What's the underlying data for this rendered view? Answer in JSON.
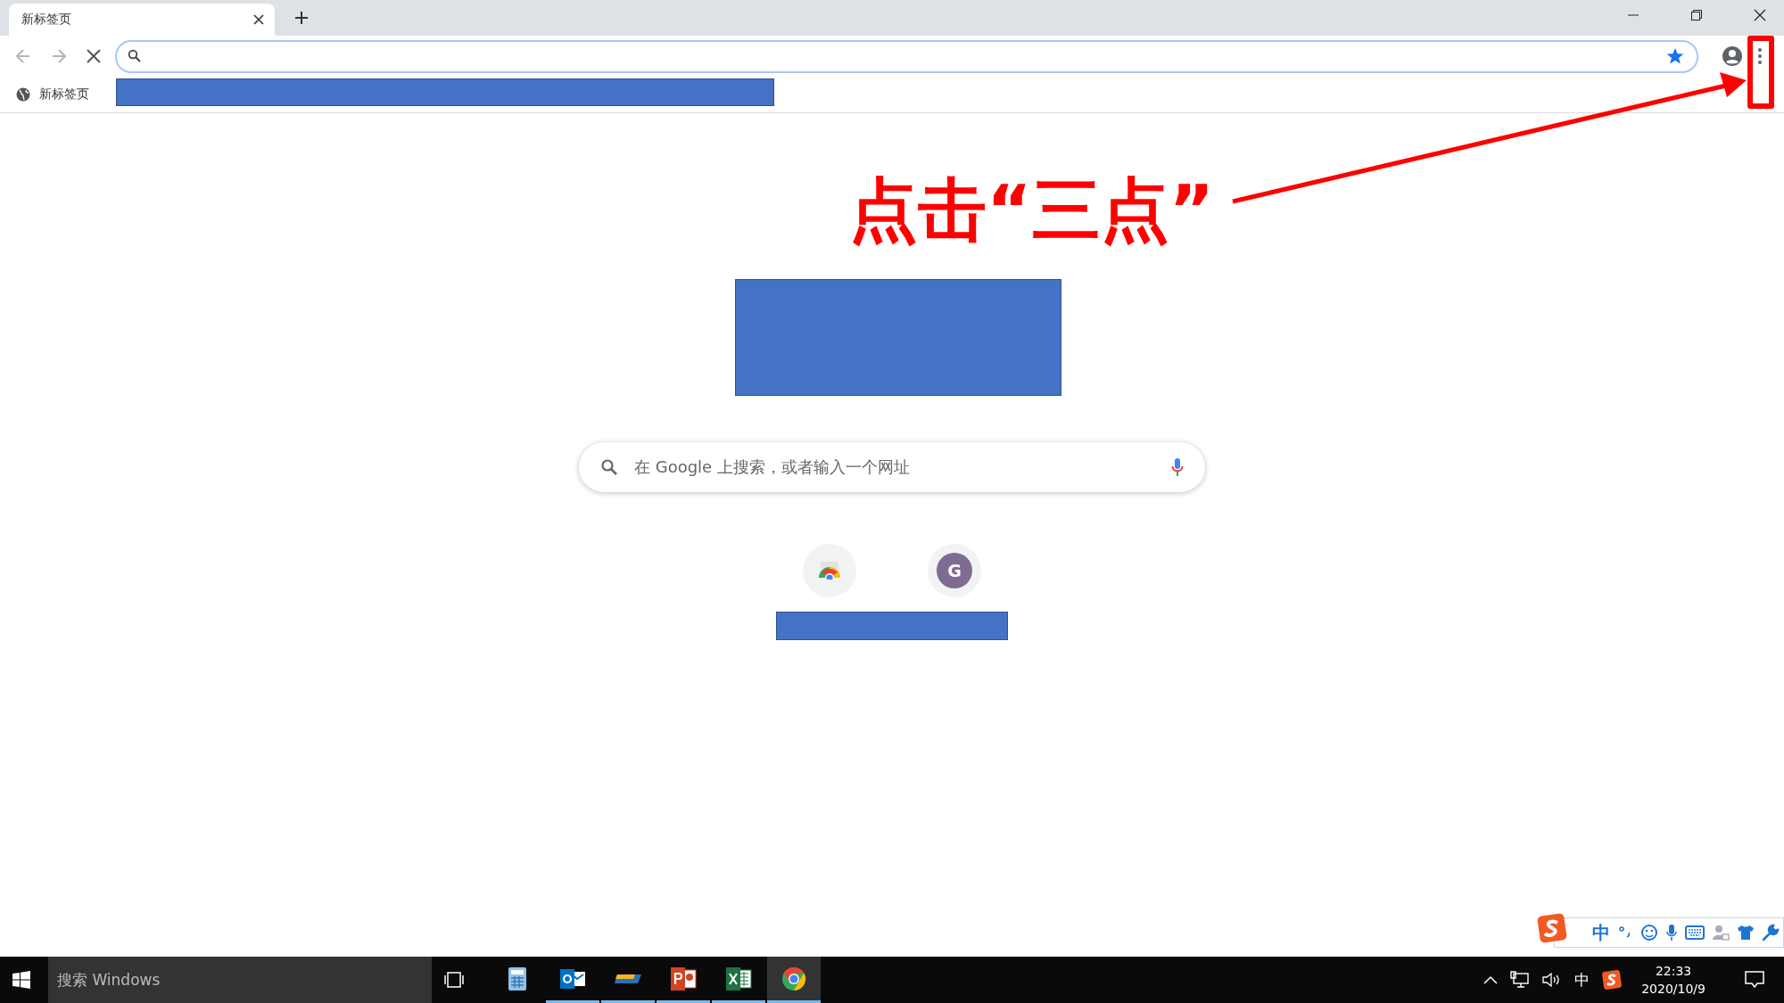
{
  "tabs": [
    {
      "title": "新标签页",
      "selected": true
    }
  ],
  "bookmarks_bar": {
    "items": [
      {
        "label": "新标签页"
      }
    ]
  },
  "annotation": {
    "text": "点击“三点”"
  },
  "new_tab_page": {
    "search": {
      "placeholder": "在 Google 上搜索，或者输入一个网址"
    },
    "shortcuts": [
      {
        "kind": "chrome"
      },
      {
        "kind": "letter",
        "letter": "G",
        "color": "#7e6c93"
      }
    ]
  },
  "ime_toolbar": {
    "mode": "中"
  },
  "taskbar": {
    "search": {
      "placeholder": "搜索 Windows"
    },
    "apps": [
      {
        "kind": "calculator",
        "running": false,
        "selected": false
      },
      {
        "kind": "outlook",
        "running": true,
        "selected": false
      },
      {
        "kind": "bar",
        "running": true,
        "selected": false
      },
      {
        "kind": "powerpoint",
        "running": true,
        "selected": false
      },
      {
        "kind": "excel",
        "running": true,
        "selected": false
      },
      {
        "kind": "chrome",
        "running": true,
        "selected": true
      }
    ],
    "tray": {
      "input_mode": "中",
      "time": "22:33",
      "date": "2020/10/9"
    }
  }
}
